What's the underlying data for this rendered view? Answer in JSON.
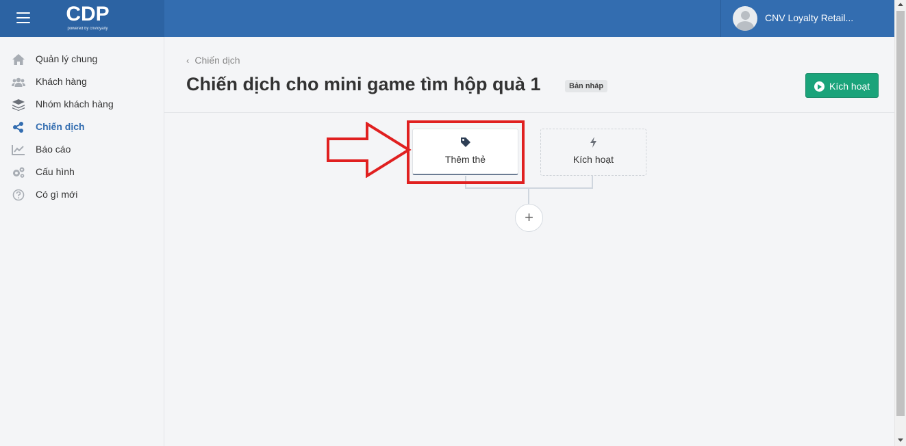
{
  "app": {
    "logo_text": "CDP",
    "logo_sub": "powered by cnvloyalty",
    "user_name": "CNV Loyalty Retail..."
  },
  "sidebar": {
    "items": [
      {
        "label": "Quản lý chung",
        "icon": "home-icon",
        "active": false
      },
      {
        "label": "Khách hàng",
        "icon": "users-icon",
        "active": false
      },
      {
        "label": "Nhóm khách hàng",
        "icon": "layers-icon",
        "active": false
      },
      {
        "label": "Chiến dịch",
        "icon": "share-icon",
        "active": true
      },
      {
        "label": "Báo cáo",
        "icon": "chart-icon",
        "active": false
      },
      {
        "label": "Cấu hình",
        "icon": "gears-icon",
        "active": false
      },
      {
        "label": "Có gì mới",
        "icon": "question-icon",
        "active": false
      }
    ]
  },
  "header": {
    "back_label": "Chiến dịch",
    "title": "Chiến dịch cho mini game tìm hộp quà 1",
    "status_badge": "Bản nháp",
    "activate_label": "Kích hoạt"
  },
  "flow": {
    "tag_card_label": "Thêm thẻ",
    "trigger_card_label": "Kích hoạt",
    "add_symbol": "+"
  },
  "colors": {
    "topbar": "#336db0",
    "accent": "#336db0",
    "activate_button": "#1aa37a",
    "highlight": "#e02020"
  }
}
